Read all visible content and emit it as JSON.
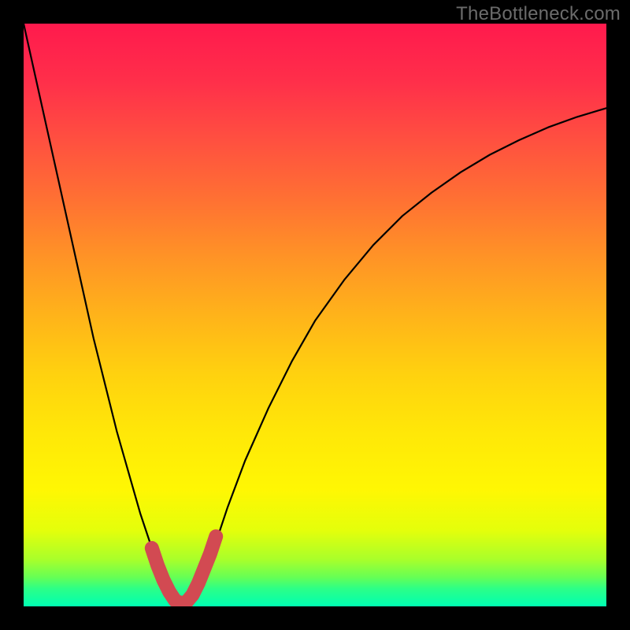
{
  "watermark": "TheBottleneck.com",
  "chart_data": {
    "type": "line",
    "title": "",
    "xlabel": "",
    "ylabel": "",
    "xlim": [
      0,
      100
    ],
    "ylim": [
      0,
      100
    ],
    "grid": false,
    "legend": false,
    "series": [
      {
        "name": "bg-gradient-stops",
        "x": [
          0,
          10,
          20,
          30,
          40,
          50,
          60,
          70,
          80,
          87,
          92,
          95,
          97,
          100
        ],
        "values": [
          "#ff1a4d",
          "#ff2f4a",
          "#ff5040",
          "#ff7033",
          "#ff9326",
          "#ffb31a",
          "#ffd10f",
          "#ffe708",
          "#fff703",
          "#e4ff0b",
          "#a8ff2b",
          "#66ff55",
          "#2bff88",
          "#00ffb2"
        ]
      },
      {
        "name": "curve",
        "note": "black V-curve; x in 0..100 (%), y = 100 top .. 0 bottom (bottleneck %)",
        "x": [
          0,
          2,
          4,
          6,
          8,
          10,
          12,
          14,
          16,
          18,
          20,
          22,
          24,
          26,
          27.5,
          29,
          31,
          33,
          35,
          38,
          42,
          46,
          50,
          55,
          60,
          65,
          70,
          75,
          80,
          85,
          90,
          95,
          100
        ],
        "values": [
          100,
          91,
          82,
          73,
          64,
          55,
          46,
          38,
          30,
          23,
          16,
          10,
          5,
          2,
          0.5,
          2,
          6,
          11,
          17,
          25,
          34,
          42,
          49,
          56,
          62,
          67,
          71,
          74.5,
          77.5,
          80,
          82.2,
          84,
          85.5
        ]
      },
      {
        "name": "highlight-bottom",
        "note": "red rounded U segment near the minimum (y values same scale as curve)",
        "x": [
          22,
          23,
          24,
          25,
          26,
          27,
          28,
          29,
          30,
          31,
          32,
          33
        ],
        "values": [
          10,
          7,
          4.5,
          2.5,
          1,
          0.5,
          0.8,
          2,
          4,
          6.5,
          9,
          12
        ]
      }
    ]
  }
}
